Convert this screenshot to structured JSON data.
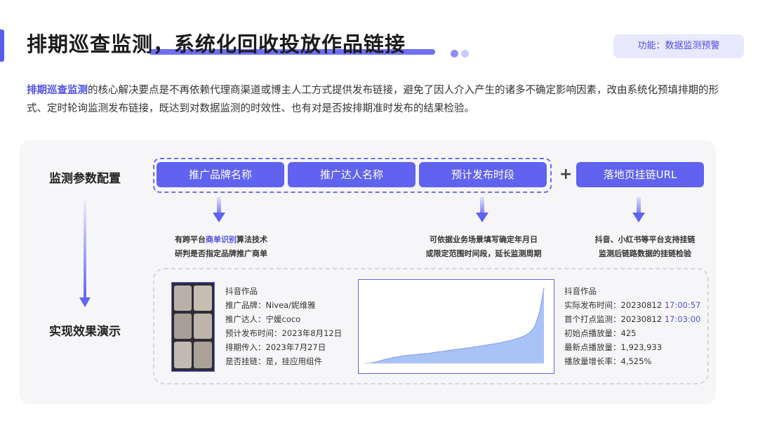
{
  "header": {
    "title": "排期巡查监测，系统化回收投放作品链接",
    "feature_badge": "功能：数据监测预警"
  },
  "description": {
    "highlight": "排期巡查监测",
    "text": "的核心解决要点是不再依赖代理商渠道或博主人工方式提供发布链接，避免了因人介入产生的诸多不确定影响因素，改由系统化预填排期的形式、定时轮询监测发布链接，既达到对数据监测的时效性、也有对是否按排期准时发布的结果检验。"
  },
  "sections": {
    "config_label": "监测参数配置",
    "result_label": "实现效果演示"
  },
  "params": {
    "brand": "推广品牌名称",
    "kol": "推广达人名称",
    "period": "预计发布时段",
    "plus": "+",
    "landing": "落地页挂链URL"
  },
  "notes": {
    "n1_pre": "有跨平台",
    "n1_hl": "商单识别",
    "n1_post": "算法技术",
    "n1_line2": "研判是否指定品牌推广商单",
    "n2_line1": "可依据业务场景填写确定年月日",
    "n2_line2": "或限定范围时间段，延长监测周期",
    "n3_line1": "抖音、小红书等平台支持挂链",
    "n3_line2": "监测后链路数据的挂链检验"
  },
  "thumbnail": {
    "caption": "抖音作品封面"
  },
  "work_info": {
    "platform": "抖音作品",
    "brand": "推广品牌：Nivea/妮维雅",
    "kol": "推广达人：宁媛coco",
    "planned_date": "预计发布时间：2023年8月12日",
    "schedule_date": "排期传入：2023年7月27日",
    "hook_link": "是否挂链：是，挂应用组件"
  },
  "monitor_info": {
    "platform": "抖音作品",
    "actual_label": "实际发布时间：20230812 ",
    "actual_time": "17:00:57",
    "first_label": "首个打点监测：20230812 ",
    "first_time": "17:03:00",
    "initial_plays": "初始点播放量：425",
    "latest_plays": "最新点播放量：1,923,933",
    "growth_rate": "播放量增长率：4,525%"
  },
  "chart_data": {
    "type": "area",
    "title": "",
    "xlabel": "",
    "ylabel": "",
    "x": [
      1,
      2,
      3,
      4,
      5,
      6,
      7,
      8,
      9,
      10,
      11,
      12,
      13,
      14,
      15,
      16,
      17,
      18,
      19,
      20,
      21,
      22,
      23,
      24,
      25,
      26,
      27,
      28,
      29,
      30,
      31,
      32,
      33,
      34,
      35,
      36,
      37,
      38,
      39,
      40
    ],
    "values": [
      425,
      8000,
      30000,
      60000,
      95000,
      120000,
      150000,
      170000,
      190000,
      205000,
      215000,
      225000,
      240000,
      250000,
      260000,
      280000,
      295000,
      310000,
      330000,
      345000,
      360000,
      375000,
      390000,
      405000,
      425000,
      440000,
      460000,
      480000,
      500000,
      520000,
      545000,
      570000,
      600000,
      630000,
      670000,
      720000,
      800000,
      950000,
      1300000,
      1923933
    ],
    "color": "#a9c3f7",
    "line_color": "#7f9ff0",
    "grid": false
  },
  "colors": {
    "accent": "#5b5cf0",
    "highlight_text": "#4d4fe8",
    "panel_bg": "#f6f6f8"
  }
}
